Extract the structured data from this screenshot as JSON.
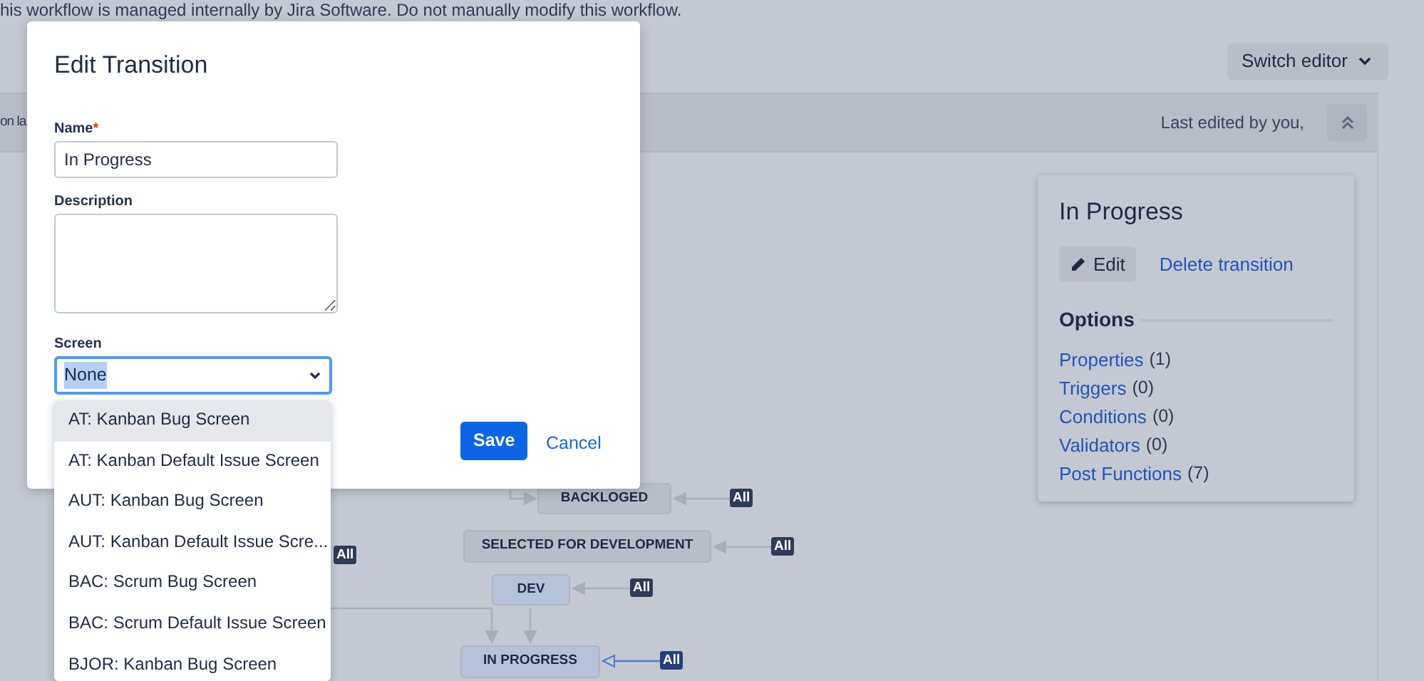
{
  "page": {
    "notice": "his workflow is managed internally by Jira Software. Do not manually modify this workflow.",
    "switch_editor": "Switch editor",
    "toolbar_left": "on la",
    "last_edited": "Last edited by you,"
  },
  "diagram": {
    "statuses": [
      {
        "label": "BACKLOGED",
        "color": "#b9bdc8"
      },
      {
        "label": "SELECTED FOR DEVELOPMENT",
        "color": "#b9bdc8"
      },
      {
        "label": "DEV",
        "color": "#b6c2d8"
      },
      {
        "label": "IN PROGRESS",
        "color": "#b6c2d8"
      }
    ],
    "global_transitions": [
      {
        "label": "All",
        "selected": false
      },
      {
        "label": "All",
        "selected": false
      },
      {
        "label": "All",
        "selected": false
      },
      {
        "label": "All",
        "selected": true
      },
      {
        "label": "All",
        "selected": false
      }
    ]
  },
  "panel": {
    "title": "In Progress",
    "edit_button": "Edit",
    "delete_link": "Delete transition",
    "options_heading": "Options",
    "options": [
      {
        "label": "Properties",
        "count": "(1)"
      },
      {
        "label": "Triggers",
        "count": "(0)"
      },
      {
        "label": "Conditions",
        "count": "(0)"
      },
      {
        "label": "Validators",
        "count": "(0)"
      },
      {
        "label": "Post Functions",
        "count": "(7)"
      }
    ]
  },
  "modal": {
    "title": "Edit Transition",
    "fields": [
      {
        "kind": "text",
        "label": "Name",
        "required_mark": "*",
        "value": "In Progress"
      },
      {
        "kind": "textarea",
        "label": "Description"
      },
      {
        "kind": "select",
        "label": "Screen",
        "value": "None"
      }
    ],
    "save": "Save",
    "cancel": "Cancel",
    "dropdown": [
      {
        "label": "AT: Kanban Bug Screen",
        "selected": true
      },
      {
        "label": "AT: Kanban Default Issue Screen",
        "selected": false
      },
      {
        "label": "AUT: Kanban Bug Screen",
        "selected": false
      },
      {
        "label": "AUT: Kanban Default Issue Scre...",
        "selected": false
      },
      {
        "label": "BAC: Scrum Bug Screen",
        "selected": false
      },
      {
        "label": "BAC: Scrum Default Issue Screen",
        "selected": false
      },
      {
        "label": "BJOR: Kanban Bug Screen",
        "selected": false
      }
    ]
  }
}
